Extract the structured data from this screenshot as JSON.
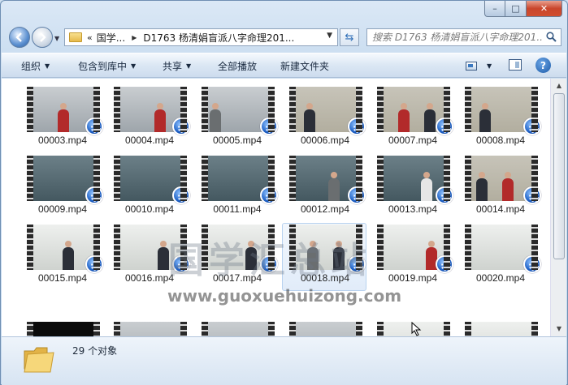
{
  "window": {
    "caption": {
      "minimize": "–",
      "maximize": "□",
      "close": "✕"
    }
  },
  "address": {
    "overflow": "«",
    "segments": [
      "国学...",
      "D1763 杨清娟盲派八字命理201..."
    ]
  },
  "search": {
    "placeholder": "搜索 D1763 杨清娟盲派八字命理201..."
  },
  "toolbar": {
    "organize": "组织",
    "include_library": "包含到库中",
    "share": "共享",
    "play_all": "全部播放",
    "new_folder": "新建文件夹",
    "help": "?"
  },
  "files": [
    "00003.mp4",
    "00004.mp4",
    "00005.mp4",
    "00006.mp4",
    "00007.mp4",
    "00008.mp4",
    "00009.mp4",
    "00010.mp4",
    "00011.mp4",
    "00012.mp4",
    "00013.mp4",
    "00014.mp4",
    "00015.mp4",
    "00016.mp4",
    "00017.mp4",
    "00018.mp4",
    "00019.mp4",
    "00020.mp4"
  ],
  "selected_file": "00018.mp4",
  "watermark": {
    "chinese": "国学汇总站",
    "url": "www.guoxuehuizong.com"
  },
  "status": {
    "item_count": "29 个对象"
  }
}
